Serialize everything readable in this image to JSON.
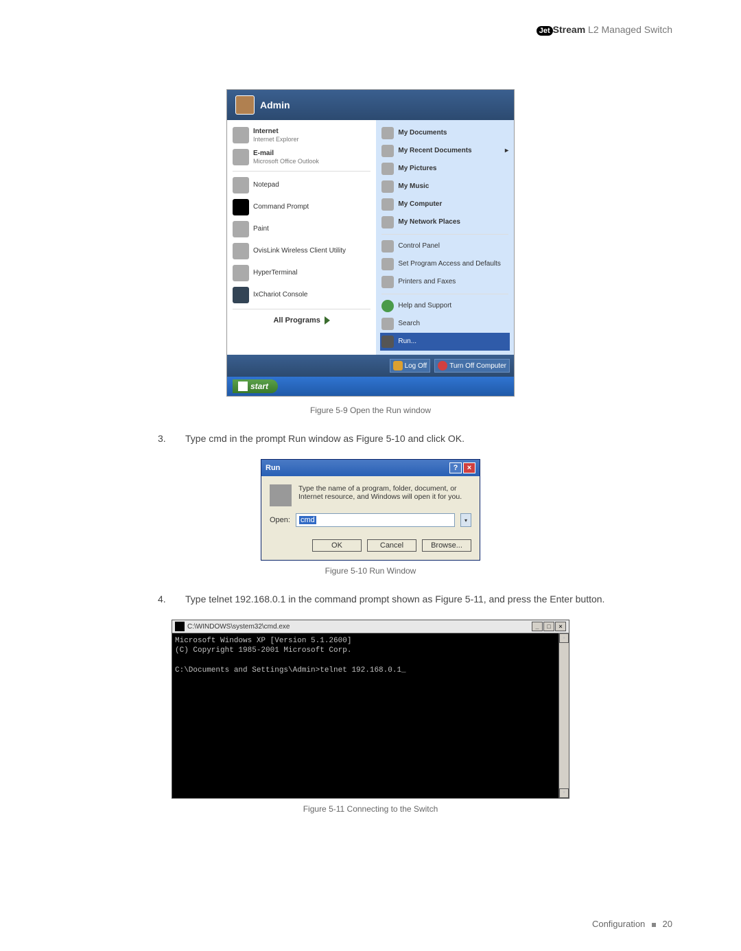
{
  "header": {
    "brand_prefix": "Jet",
    "brand_suffix": "Stream",
    "product": " L2 Managed Switch"
  },
  "startmenu": {
    "user": "Admin",
    "left_items": [
      {
        "main": "Internet",
        "sub": "Internet Explorer"
      },
      {
        "main": "E-mail",
        "sub": "Microsoft Office Outlook"
      }
    ],
    "left_recent": [
      "Notepad",
      "Command Prompt",
      "Paint",
      "OvisLink Wireless Client Utility",
      "HyperTerminal",
      "IxChariot Console"
    ],
    "all_programs": "All Programs",
    "right_bold": [
      "My Documents",
      "My Recent Documents",
      "My Pictures",
      "My Music",
      "My Computer",
      "My Network Places"
    ],
    "right_plain": [
      "Control Panel",
      "Set Program Access and Defaults",
      "Printers and Faxes",
      "Help and Support",
      "Search"
    ],
    "run_item": "Run...",
    "logoff": "Log Off",
    "turnoff": "Turn Off Computer",
    "start_btn": "start"
  },
  "caption1": "Figure 5-9  Open the Run window",
  "step3": "Type cmd in the prompt Run window as Figure 5-10 and click OK.",
  "rundialog": {
    "title": "Run",
    "desc": "Type the name of a program, folder, document, or Internet resource, and Windows will open it for you.",
    "open_label": "Open:",
    "open_value": "cmd",
    "btn_ok": "OK",
    "btn_cancel": "Cancel",
    "btn_browse": "Browse..."
  },
  "caption2": "Figure 5-10  Run Window",
  "step4": "Type telnet 192.168.0.1 in the command prompt shown as Figure 5-11, and press the Enter button.",
  "cmdwin": {
    "title": "C:\\WINDOWS\\system32\\cmd.exe",
    "line1": "Microsoft Windows XP [Version 5.1.2600]",
    "line2": "(C) Copyright 1985-2001 Microsoft Corp.",
    "line3": "C:\\Documents and Settings\\Admin>telnet 192.168.0.1_"
  },
  "caption3": "Figure 5-11  Connecting to the Switch",
  "footer": {
    "section": "Configuration",
    "page": "20"
  }
}
